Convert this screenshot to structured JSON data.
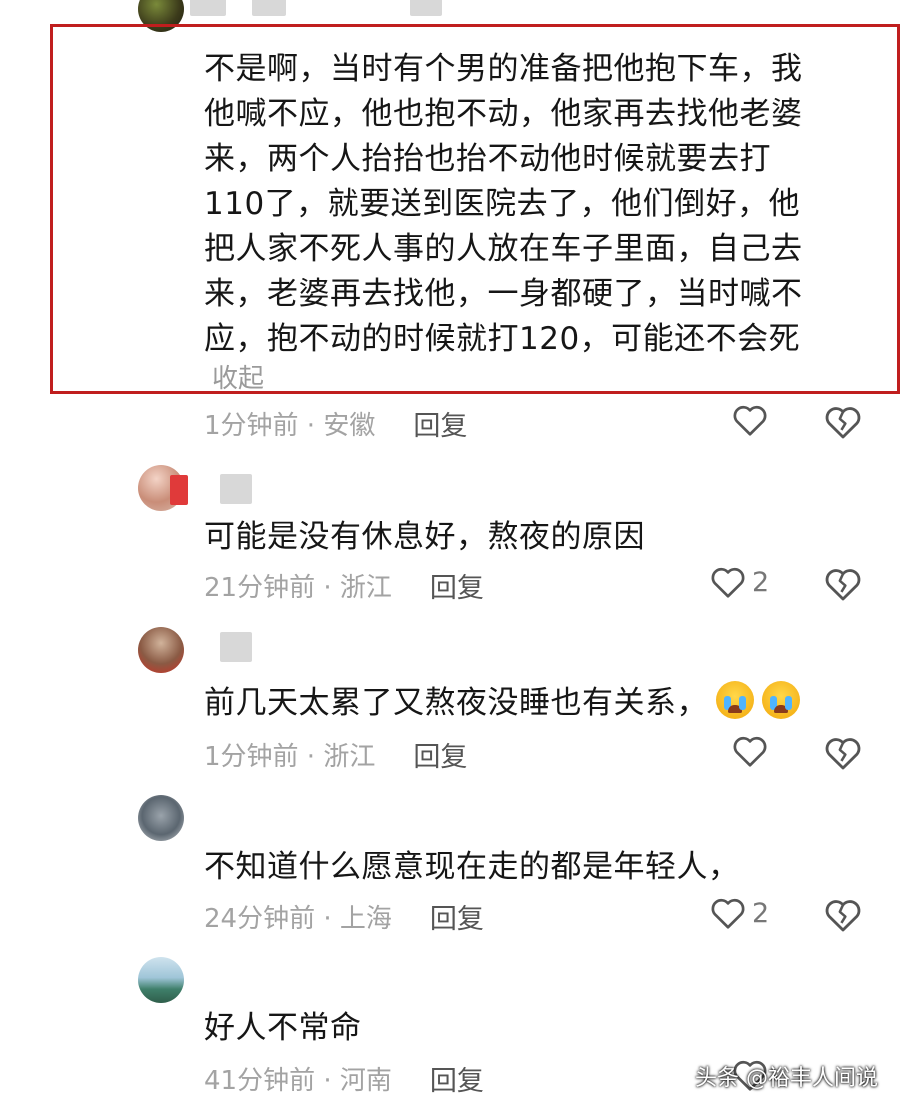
{
  "comments": [
    {
      "text": "不是啊，当时有个男的准备把他抱下车，我\n他喊不应，他也抱不动，他家再去找他老婆\n来，两个人抬抬也抬不动他时候就要去打\n110了，就要送到医院去了，他们倒好，他\n把人家不死人事的人放在车子里面，自己去\n来，老婆再去找他，一身都硬了，当时喊不\n应，抱不动的时候就打120，可能还不会死",
      "collapse": "收起",
      "meta": "1分钟前 · 安徽",
      "reply": "回复",
      "likes": ""
    },
    {
      "text": "可能是没有休息好，熬夜的原因",
      "meta": "21分钟前 · 浙江",
      "reply": "回复",
      "likes": "2"
    },
    {
      "text": "前几天太累了又熬夜没睡也有关系，",
      "meta": "1分钟前 · 浙江",
      "reply": "回复",
      "likes": ""
    },
    {
      "text": "不知道什么愿意现在走的都是年轻人，",
      "meta": "24分钟前 · 上海",
      "reply": "回复",
      "likes": "2"
    },
    {
      "text": "好人不常命",
      "meta": "41分钟前 · 河南",
      "reply": "回复",
      "likes": ""
    }
  ],
  "watermark": "头条 @裕丰人间说",
  "icons": {
    "like": "heart-outline-icon",
    "dislike": "broken-heart-icon",
    "emoji": "crying-face-emoji"
  },
  "colors": {
    "highlight": "#c01e1e",
    "meta": "#a3a3a3"
  }
}
